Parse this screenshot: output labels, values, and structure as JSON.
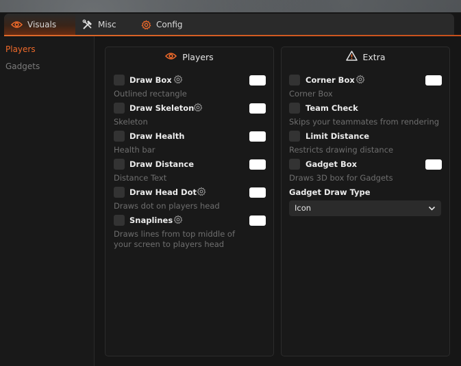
{
  "tabs": [
    {
      "label": "Visuals",
      "icon": "eye-icon",
      "active": true
    },
    {
      "label": "Misc",
      "icon": "tools-icon",
      "active": false
    },
    {
      "label": "Config",
      "icon": "gear-icon",
      "active": false
    }
  ],
  "sidebar": {
    "items": [
      {
        "label": "Players",
        "active": true
      },
      {
        "label": "Gadgets",
        "active": false
      }
    ]
  },
  "panels": {
    "players": {
      "title": "Players",
      "icon": "eye-icon",
      "options": [
        {
          "label": "Draw Box",
          "desc": "Outlined rectangle",
          "checked": false,
          "has_settings": true
        },
        {
          "label": "Draw Skeleton",
          "desc": "Skeleton",
          "checked": false,
          "has_settings": true
        },
        {
          "label": "Draw Health",
          "desc": "Health bar",
          "checked": false,
          "has_settings": false
        },
        {
          "label": "Draw Distance",
          "desc": "Distance Text",
          "checked": false,
          "has_settings": false
        },
        {
          "label": "Draw Head Dot",
          "desc": "Draws dot on players head",
          "checked": false,
          "has_settings": true
        },
        {
          "label": "Snaplines",
          "desc_line1": "Draws lines from top middle of",
          "desc_line2": "your screen to players head",
          "checked": false,
          "has_settings": true
        }
      ]
    },
    "extra": {
      "title": "Extra",
      "icon": "warning-icon",
      "options": [
        {
          "label": "Corner Box",
          "desc": "Corner Box",
          "checked": false,
          "has_settings": true
        },
        {
          "label": "Team Check",
          "desc": "Skips your teammates from rendering",
          "checked": false,
          "has_settings": false
        },
        {
          "label": "Limit Distance",
          "desc": "Restricts drawing distance",
          "checked": false,
          "has_settings": false
        },
        {
          "label": "Gadget Box",
          "desc": "Draws 3D box for Gadgets",
          "checked": false,
          "has_settings": false
        }
      ],
      "dropdown": {
        "label": "Gadget Draw Type",
        "value": "Icon"
      }
    }
  },
  "colors": {
    "accent": "#f06a2a",
    "panel_bg": "#191919",
    "window_bg": "#161616"
  }
}
